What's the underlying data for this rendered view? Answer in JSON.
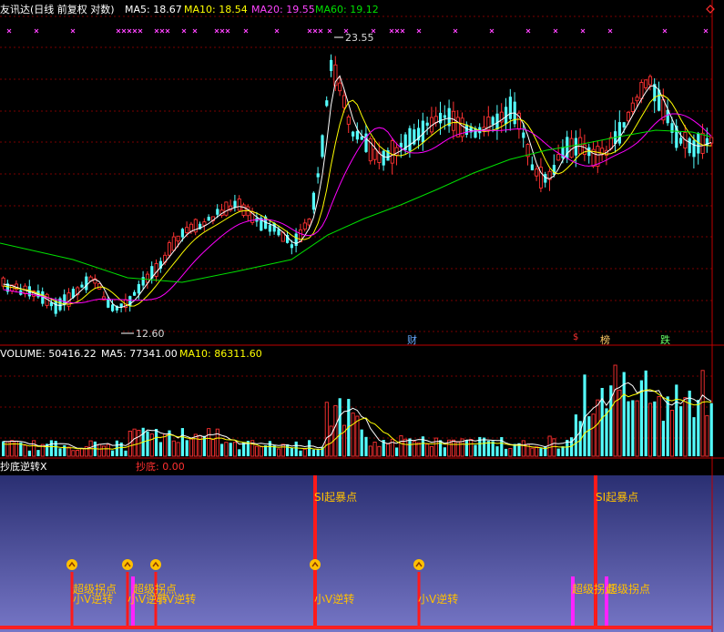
{
  "price_panel": {
    "title": "友讯达(日线 前复权 对数)",
    "ma5": "MA5: 18.67",
    "ma10": "MA10: 18.54",
    "ma20": "MA20: 19.55",
    "ma60": "MA60: 19.12",
    "high_label": "23.55",
    "low_label": "12.60",
    "corner_icon": "diamond-icon",
    "event_tags": {
      "cai": "财",
      "bang": "榜",
      "die": "跌",
      "dollar": "$"
    }
  },
  "volume_panel": {
    "volume": "VOLUME: 50416.22",
    "ma5": "MA5: 77341.00",
    "ma10": "MA10: 86311.60"
  },
  "indicator_panel": {
    "title": "抄底逆转X",
    "value": "抄底: 0.00",
    "signals": [
      "SI起暴点",
      "SI起暴点",
      "超级拐点",
      "小V逆转",
      "超级拐点",
      "小V逆转",
      "小V逆转",
      "小V逆转",
      "小V逆转",
      "超级拐点",
      "超级拐点"
    ]
  },
  "colors": {
    "up": "#ff3232",
    "down": "#54ffff",
    "ma5": "#ffffff",
    "ma10": "#ffff00",
    "ma20": "#ff00ff",
    "ma60": "#00e000",
    "signal": "#ffc000",
    "mark": "#ff44ff"
  }
}
